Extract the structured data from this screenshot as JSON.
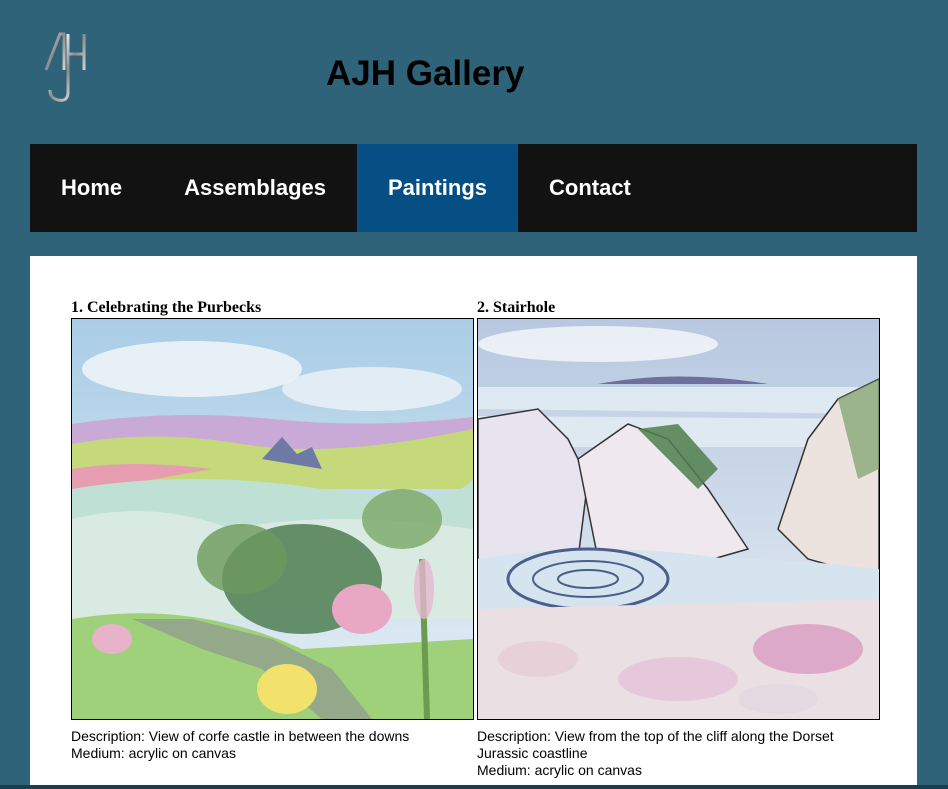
{
  "site": {
    "title": "AJH Gallery",
    "logo_text": "AJH"
  },
  "nav": {
    "items": [
      {
        "label": "Home",
        "active": false
      },
      {
        "label": "Assemblages",
        "active": false
      },
      {
        "label": "Paintings",
        "active": true
      },
      {
        "label": "Contact",
        "active": false
      }
    ]
  },
  "paintings": [
    {
      "title": "1. Celebrating the Purbecks",
      "description": "Description: View of corfe castle in between the downs",
      "medium": "Medium: acrylic on canvas"
    },
    {
      "title": "2. Stairhole",
      "description": "Description: View from the top of the cliff along the Dorset Jurassic coastline",
      "medium": "Medium: acrylic on canvas"
    }
  ],
  "colors": {
    "page_bg": "#2f6379",
    "nav_bg": "#121212",
    "nav_active": "#064f84",
    "content_bg": "#ffffff"
  }
}
